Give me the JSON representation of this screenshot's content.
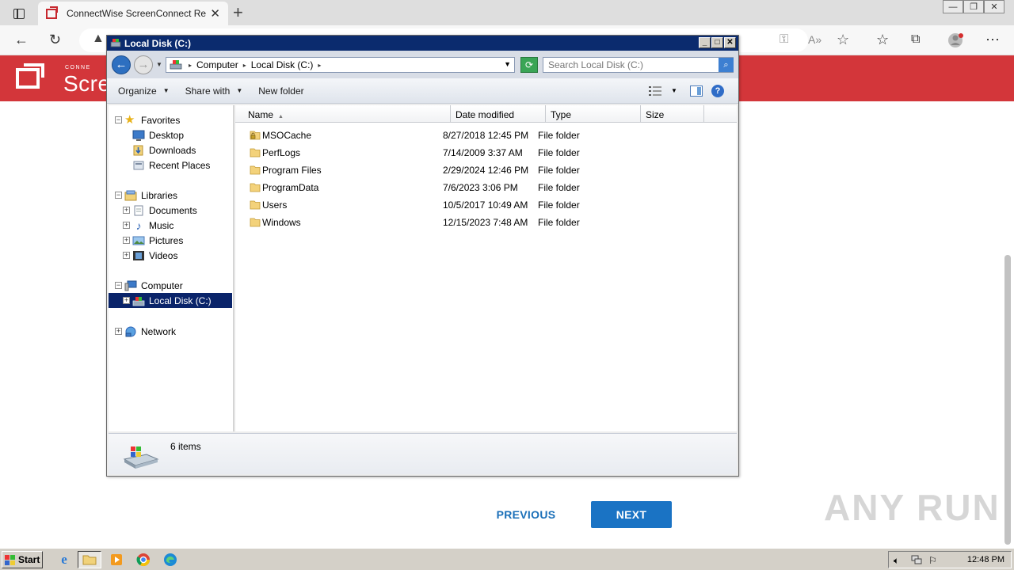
{
  "browser": {
    "tab_title": "ConnectWise ScreenConnect Ren",
    "tab_close": "✕",
    "new_tab": "+",
    "window_controls": [
      "—",
      "❐",
      "✕"
    ]
  },
  "page": {
    "brand_small": "CONNE",
    "brand_large": "Scre",
    "prev_label": "PREVIOUS",
    "next_label": "NEXT",
    "watermark": "ANY RUN"
  },
  "explorer": {
    "title": "Local Disk (C:)",
    "title_buttons": [
      "_",
      "□",
      "✕"
    ],
    "breadcrumbs": [
      "Computer",
      "Local Disk (C:)"
    ],
    "search_placeholder": "Search Local Disk (C:)",
    "commands": [
      {
        "label": "Organize",
        "dropdown": true
      },
      {
        "label": "Share with",
        "dropdown": true
      },
      {
        "label": "New folder",
        "dropdown": false
      }
    ],
    "nav_pane": {
      "favorites": {
        "label": "Favorites",
        "items": [
          "Desktop",
          "Downloads",
          "Recent Places"
        ]
      },
      "libraries": {
        "label": "Libraries",
        "items": [
          "Documents",
          "Music",
          "Pictures",
          "Videos"
        ]
      },
      "computer": {
        "label": "Computer",
        "items": [
          "Local Disk (C:)"
        ]
      },
      "network": {
        "label": "Network"
      }
    },
    "columns": [
      "Name",
      "Date modified",
      "Type",
      "Size"
    ],
    "files": [
      {
        "name": "MSOCache",
        "date": "8/27/2018 12:45 PM",
        "type": "File folder",
        "locked": true
      },
      {
        "name": "PerfLogs",
        "date": "7/14/2009 3:37 AM",
        "type": "File folder",
        "locked": false
      },
      {
        "name": "Program Files",
        "date": "2/29/2024 12:46 PM",
        "type": "File folder",
        "locked": false
      },
      {
        "name": "ProgramData",
        "date": "7/6/2023 3:06 PM",
        "type": "File folder",
        "locked": false
      },
      {
        "name": "Users",
        "date": "10/5/2017 10:49 AM",
        "type": "File folder",
        "locked": false
      },
      {
        "name": "Windows",
        "date": "12/15/2023 7:48 AM",
        "type": "File folder",
        "locked": false
      }
    ],
    "status": "6 items"
  },
  "taskbar": {
    "start_label": "Start",
    "clock": "12:48 PM"
  },
  "colors": {
    "brand_red": "#d3363a",
    "next_blue": "#1a73c4",
    "selection": "#0a246a"
  }
}
